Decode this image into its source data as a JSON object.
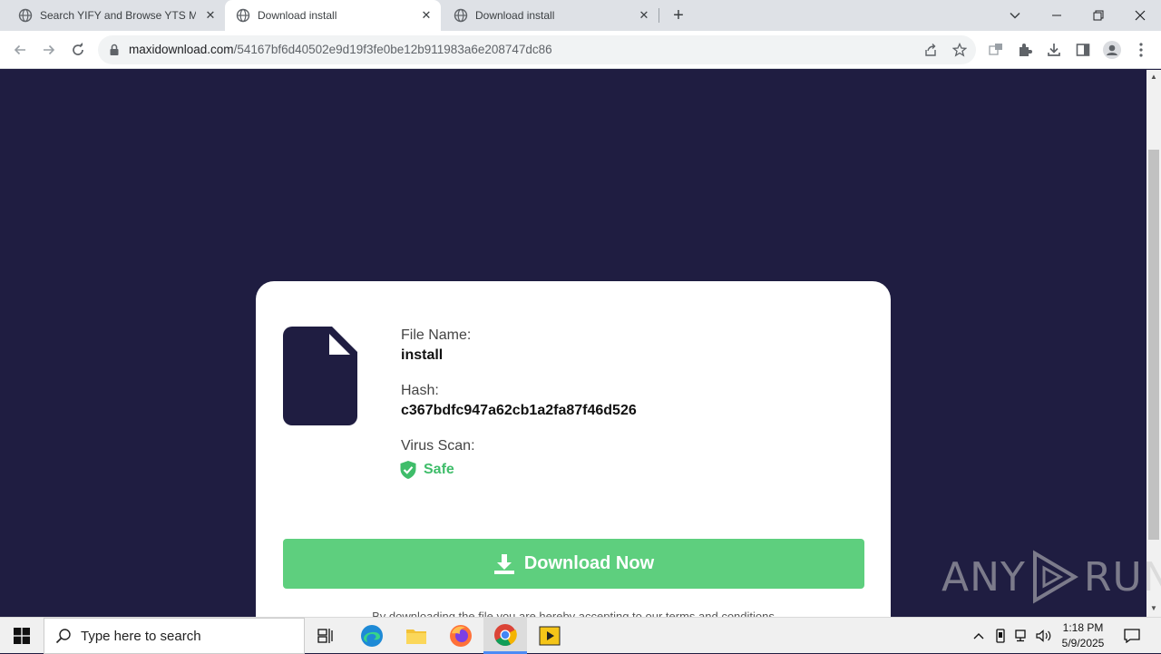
{
  "browser": {
    "tabs": [
      {
        "label": "Search YIFY and Browse YTS Mo",
        "active": false
      },
      {
        "label": "Download install",
        "active": true
      },
      {
        "label": "Download install",
        "active": false
      }
    ],
    "address": {
      "host": "maxidownload.com",
      "path": "/54167bf6d40502e9d19f3fe0be12b911983a6e208747dc86"
    }
  },
  "card": {
    "file_name_label": "File Name:",
    "file_name": "install",
    "hash_label": "Hash:",
    "hash": "c367bdfc947a62cb1a2fa87f46d526",
    "virus_scan_label": "Virus Scan:",
    "virus_scan_status": "Safe",
    "download_button": "Download Now",
    "terms": "By downloading the file you are hereby accepting to our terms and conditions"
  },
  "watermark": {
    "left": "ANY",
    "right": "RUN"
  },
  "taskbar": {
    "search_placeholder": "Type here to search",
    "time": "1:18 PM",
    "date": "5/9/2025"
  },
  "colors": {
    "page_bg": "#1f1d41",
    "accent_green": "#5ecf7e",
    "safe_green": "#3fbd6a"
  }
}
